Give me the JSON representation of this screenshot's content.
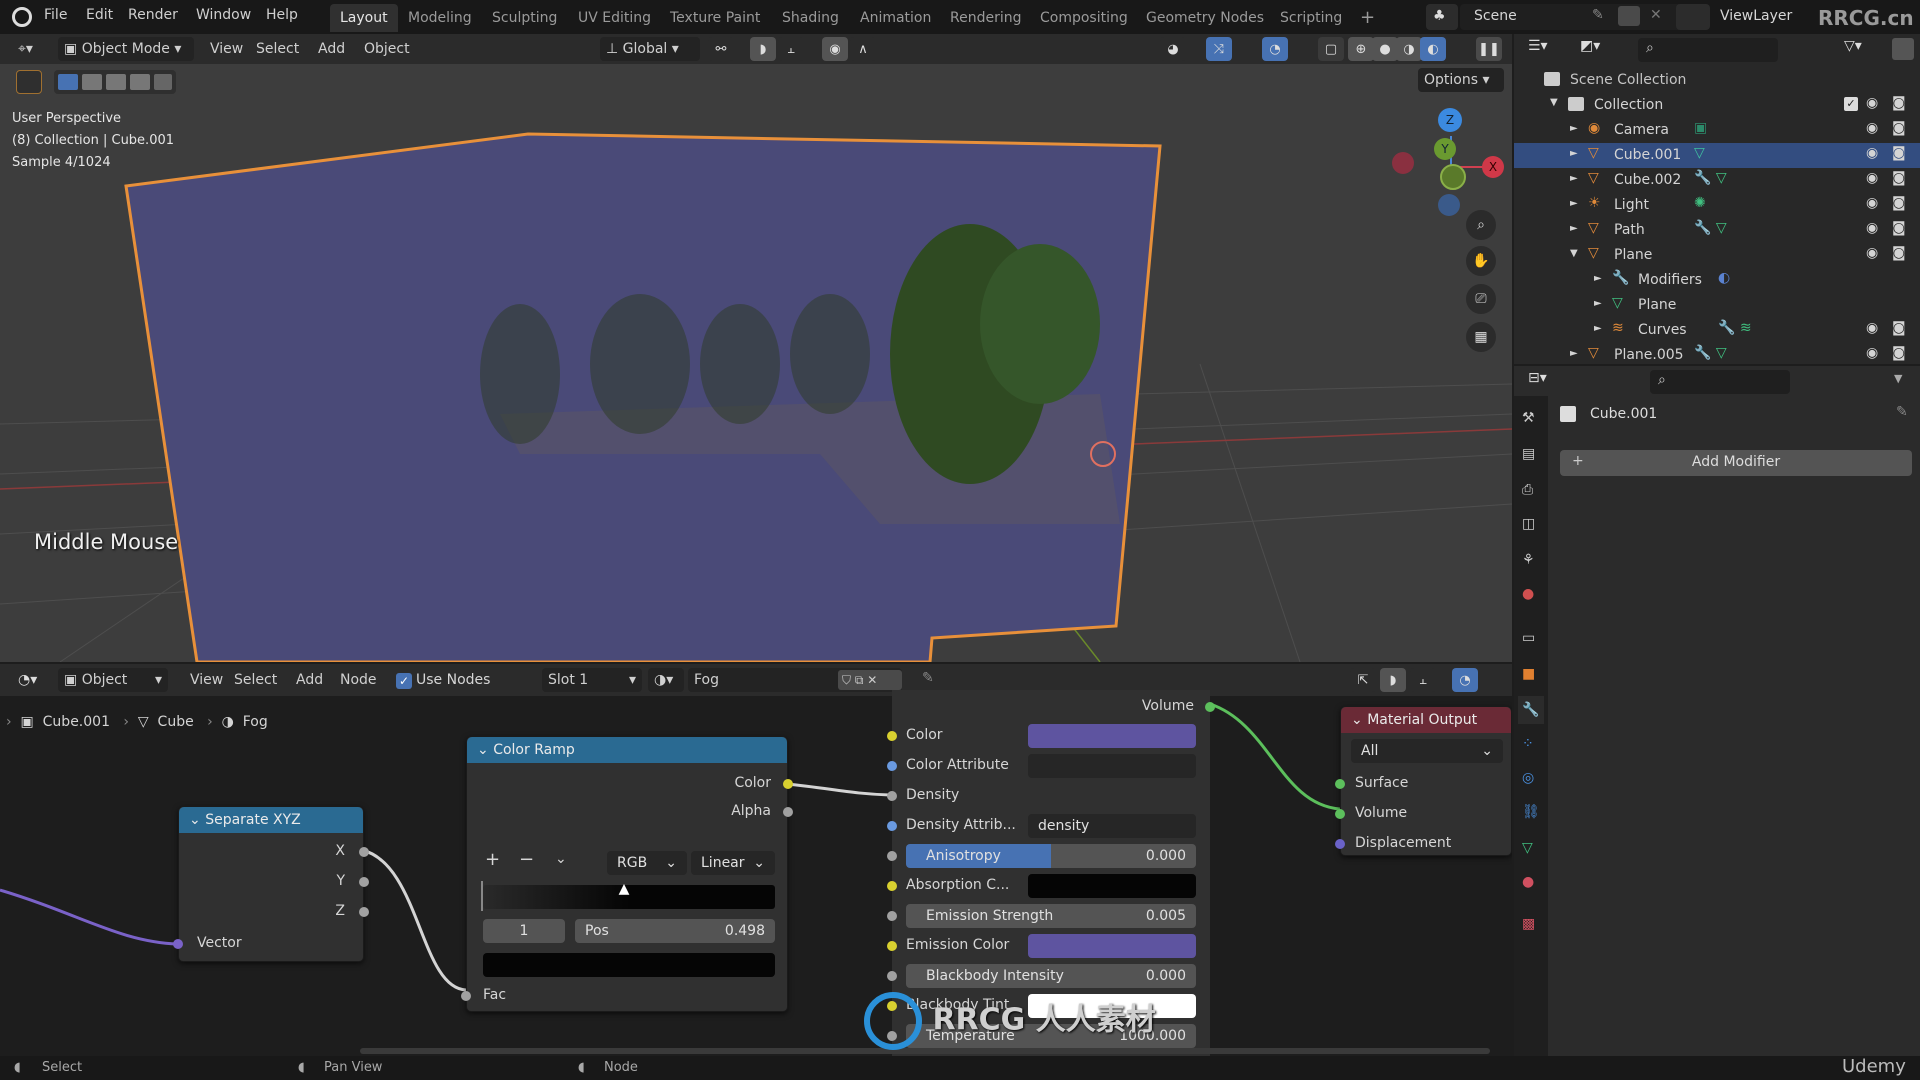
{
  "topbar": {
    "menus": [
      "File",
      "Edit",
      "Render",
      "Window",
      "Help"
    ],
    "workspaces": [
      "Layout",
      "Modeling",
      "Sculpting",
      "UV Editing",
      "Texture Paint",
      "Shading",
      "Animation",
      "Rendering",
      "Compositing",
      "Geometry Nodes",
      "Scripting"
    ],
    "active_workspace": "Layout",
    "add_workspace": "+",
    "scene": "Scene",
    "view_layer": "ViewLayer",
    "watermark": "RRCG.cn"
  },
  "viewport": {
    "mode": "Object Mode",
    "menus": [
      "View",
      "Select",
      "Add",
      "Object"
    ],
    "orientation": "Global",
    "options_label": "Options",
    "overlay_lines": [
      "User Perspective",
      "(8) Collection | Cube.001",
      "Sample 4/1024"
    ],
    "keystroke_hint": "Middle Mouse",
    "gizmo": {
      "x": "X",
      "y": "Y",
      "z": "Z"
    },
    "colors": {
      "selection_outline": "#e8903a",
      "fog": "#4a4a7a"
    }
  },
  "outliner": {
    "root": "Scene Collection",
    "collection": "Collection",
    "items": [
      {
        "name": "Camera",
        "type": "camera",
        "selected": false
      },
      {
        "name": "Cube.001",
        "type": "mesh",
        "selected": true
      },
      {
        "name": "Cube.002",
        "type": "mesh",
        "selected": false
      },
      {
        "name": "Light",
        "type": "light",
        "selected": false
      },
      {
        "name": "Path",
        "type": "mesh",
        "selected": false
      },
      {
        "name": "Plane",
        "type": "mesh",
        "selected": false,
        "expanded": true
      },
      {
        "name": "Modifiers",
        "type": "modifiers",
        "child": true
      },
      {
        "name": "Plane",
        "type": "mesh-data",
        "child": true
      },
      {
        "name": "Curves",
        "type": "curves",
        "child": true
      },
      {
        "name": "Plane.005",
        "type": "mesh",
        "selected": false
      }
    ]
  },
  "properties": {
    "object_name": "Cube.001",
    "add_modifier_label": "Add Modifier"
  },
  "node_editor": {
    "header": {
      "object_dropdown": "Object",
      "menus": [
        "View",
        "Select",
        "Add",
        "Node"
      ],
      "use_nodes_label": "Use Nodes",
      "use_nodes_checked": true,
      "slot": "Slot 1",
      "material": "Fog"
    },
    "breadcrumb": [
      "Cube.001",
      "Cube",
      "Fog"
    ],
    "separate_xyz": {
      "title": "Separate XYZ",
      "outputs": [
        "X",
        "Y",
        "Z"
      ],
      "input": "Vector"
    },
    "color_ramp": {
      "title": "Color Ramp",
      "outputs": [
        "Color",
        "Alpha"
      ],
      "color_mode": "RGB",
      "interpolation": "Linear",
      "add": "+",
      "remove": "−",
      "active_index": "1",
      "pos_label": "Pos",
      "pos_value": "0.498",
      "input": "Fac"
    },
    "volume_node": {
      "output": "Volume",
      "rows": [
        {
          "label": "Color",
          "kind": "color",
          "value": "#5e54a0"
        },
        {
          "label": "Color Attribute",
          "kind": "text",
          "value": ""
        },
        {
          "label": "Density",
          "kind": "socket",
          "value": ""
        },
        {
          "label": "Density Attrib...",
          "kind": "text",
          "value": "density"
        },
        {
          "label": "Anisotropy",
          "kind": "slider",
          "value": "0.000"
        },
        {
          "label": "Absorption C...",
          "kind": "color",
          "value": "#050505"
        },
        {
          "label": "Emission Strength",
          "kind": "slider",
          "value": "0.005"
        },
        {
          "label": "Emission Color",
          "kind": "color",
          "value": "#5e54a0"
        },
        {
          "label": "Blackbody Intensity",
          "kind": "slider",
          "value": "0.000"
        },
        {
          "label": "Blackbody Tint",
          "kind": "color",
          "value": "#ffffff"
        },
        {
          "label": "Temperature",
          "kind": "slider",
          "value": "1000.000"
        }
      ]
    },
    "material_output": {
      "title": "Material Output",
      "target": "All",
      "inputs": [
        "Surface",
        "Volume",
        "Displacement"
      ]
    }
  },
  "statusbar": {
    "items": [
      "Select",
      "Pan View",
      "Node"
    ],
    "brand": "Udemy",
    "watermark": "RRCG 人人素材"
  }
}
